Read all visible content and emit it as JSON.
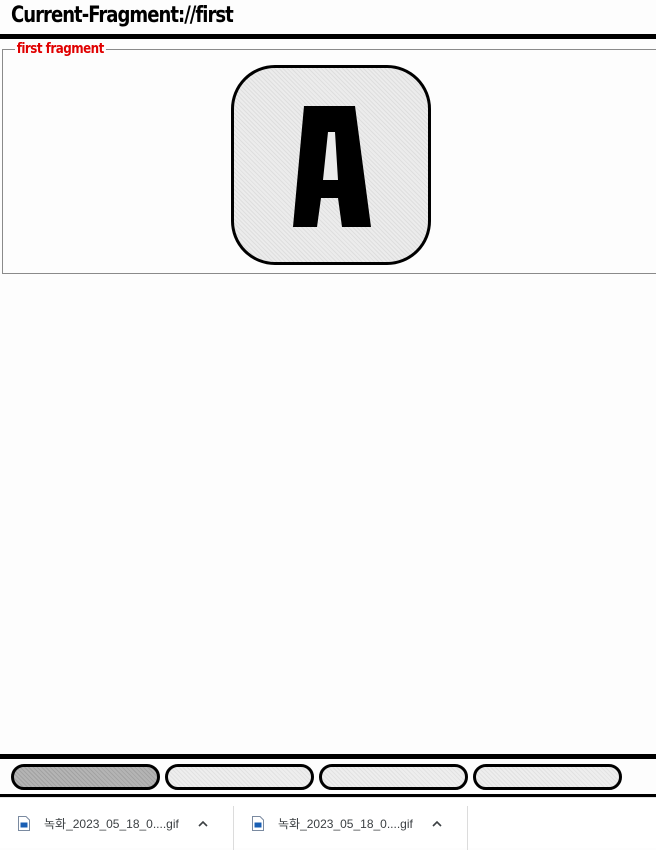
{
  "header": {
    "title": "Current-Fragment://first"
  },
  "fragment": {
    "legend": "first fragment",
    "letter": "A"
  },
  "tabs": [
    {
      "label": "",
      "active": true
    },
    {
      "label": "",
      "active": false
    },
    {
      "label": "",
      "active": false
    },
    {
      "label": "",
      "active": false
    }
  ],
  "downloads": [
    {
      "filename": "녹화_2023_05_18_0....gif",
      "icon": "gif-file-icon"
    },
    {
      "filename": "녹화_2023_05_18_0....gif",
      "icon": "gif-file-icon"
    }
  ],
  "colors": {
    "legend": "#e00000",
    "active_tab": "#b4b4b4",
    "inactive_tab": "#eeeeee"
  }
}
